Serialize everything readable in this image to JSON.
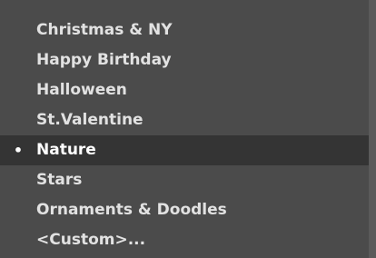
{
  "menu": {
    "bullet_glyph": "•",
    "items": [
      {
        "label": "Christmas & NY",
        "selected": false
      },
      {
        "label": "Happy Birthday",
        "selected": false
      },
      {
        "label": "Halloween",
        "selected": false
      },
      {
        "label": "St.Valentine",
        "selected": false
      },
      {
        "label": "Nature",
        "selected": true
      },
      {
        "label": "Stars",
        "selected": false
      },
      {
        "label": "Ornaments & Doodles",
        "selected": false
      },
      {
        "label": "<Custom>...",
        "selected": false
      }
    ]
  },
  "colors": {
    "menu_background": "#4b4b4b",
    "selected_background": "#343434",
    "text": "#e2e2e2",
    "selected_text": "#ffffff"
  }
}
